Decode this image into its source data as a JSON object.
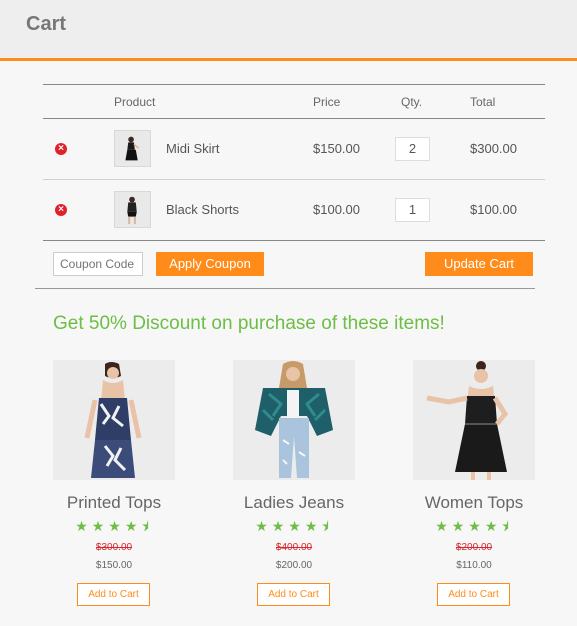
{
  "header": {
    "title": "Cart"
  },
  "table": {
    "headers": {
      "product": "Product",
      "price": "Price",
      "qty": "Qty.",
      "total": "Total"
    },
    "rows": [
      {
        "name": "Midi Skirt",
        "price": "$150.00",
        "qty": "2",
        "total": "$300.00"
      },
      {
        "name": "Black Shorts",
        "price": "$100.00",
        "qty": "1",
        "total": "$100.00"
      }
    ]
  },
  "actions": {
    "coupon_placeholder": "Coupon Code",
    "apply_coupon": "Apply Coupon",
    "update_cart": "Update Cart"
  },
  "promo": {
    "heading": "Get 50% Discount on purchase of these items!",
    "items": [
      {
        "name": "Printed Tops",
        "rating": 4.5,
        "old_price": "$300.00",
        "new_price": "$150.00",
        "button": "Add to Cart"
      },
      {
        "name": "Ladies Jeans",
        "rating": 4.5,
        "old_price": "$400.00",
        "new_price": "$200.00",
        "button": "Add to Cart"
      },
      {
        "name": "Women Tops",
        "rating": 4.5,
        "old_price": "$200.00",
        "new_price": "$110.00",
        "button": "Add to Cart"
      }
    ]
  },
  "colors": {
    "accent": "#ff8c1a",
    "promo_green": "#6cbe45",
    "remove_red": "#e0232a",
    "strike_red": "#d9262c"
  }
}
